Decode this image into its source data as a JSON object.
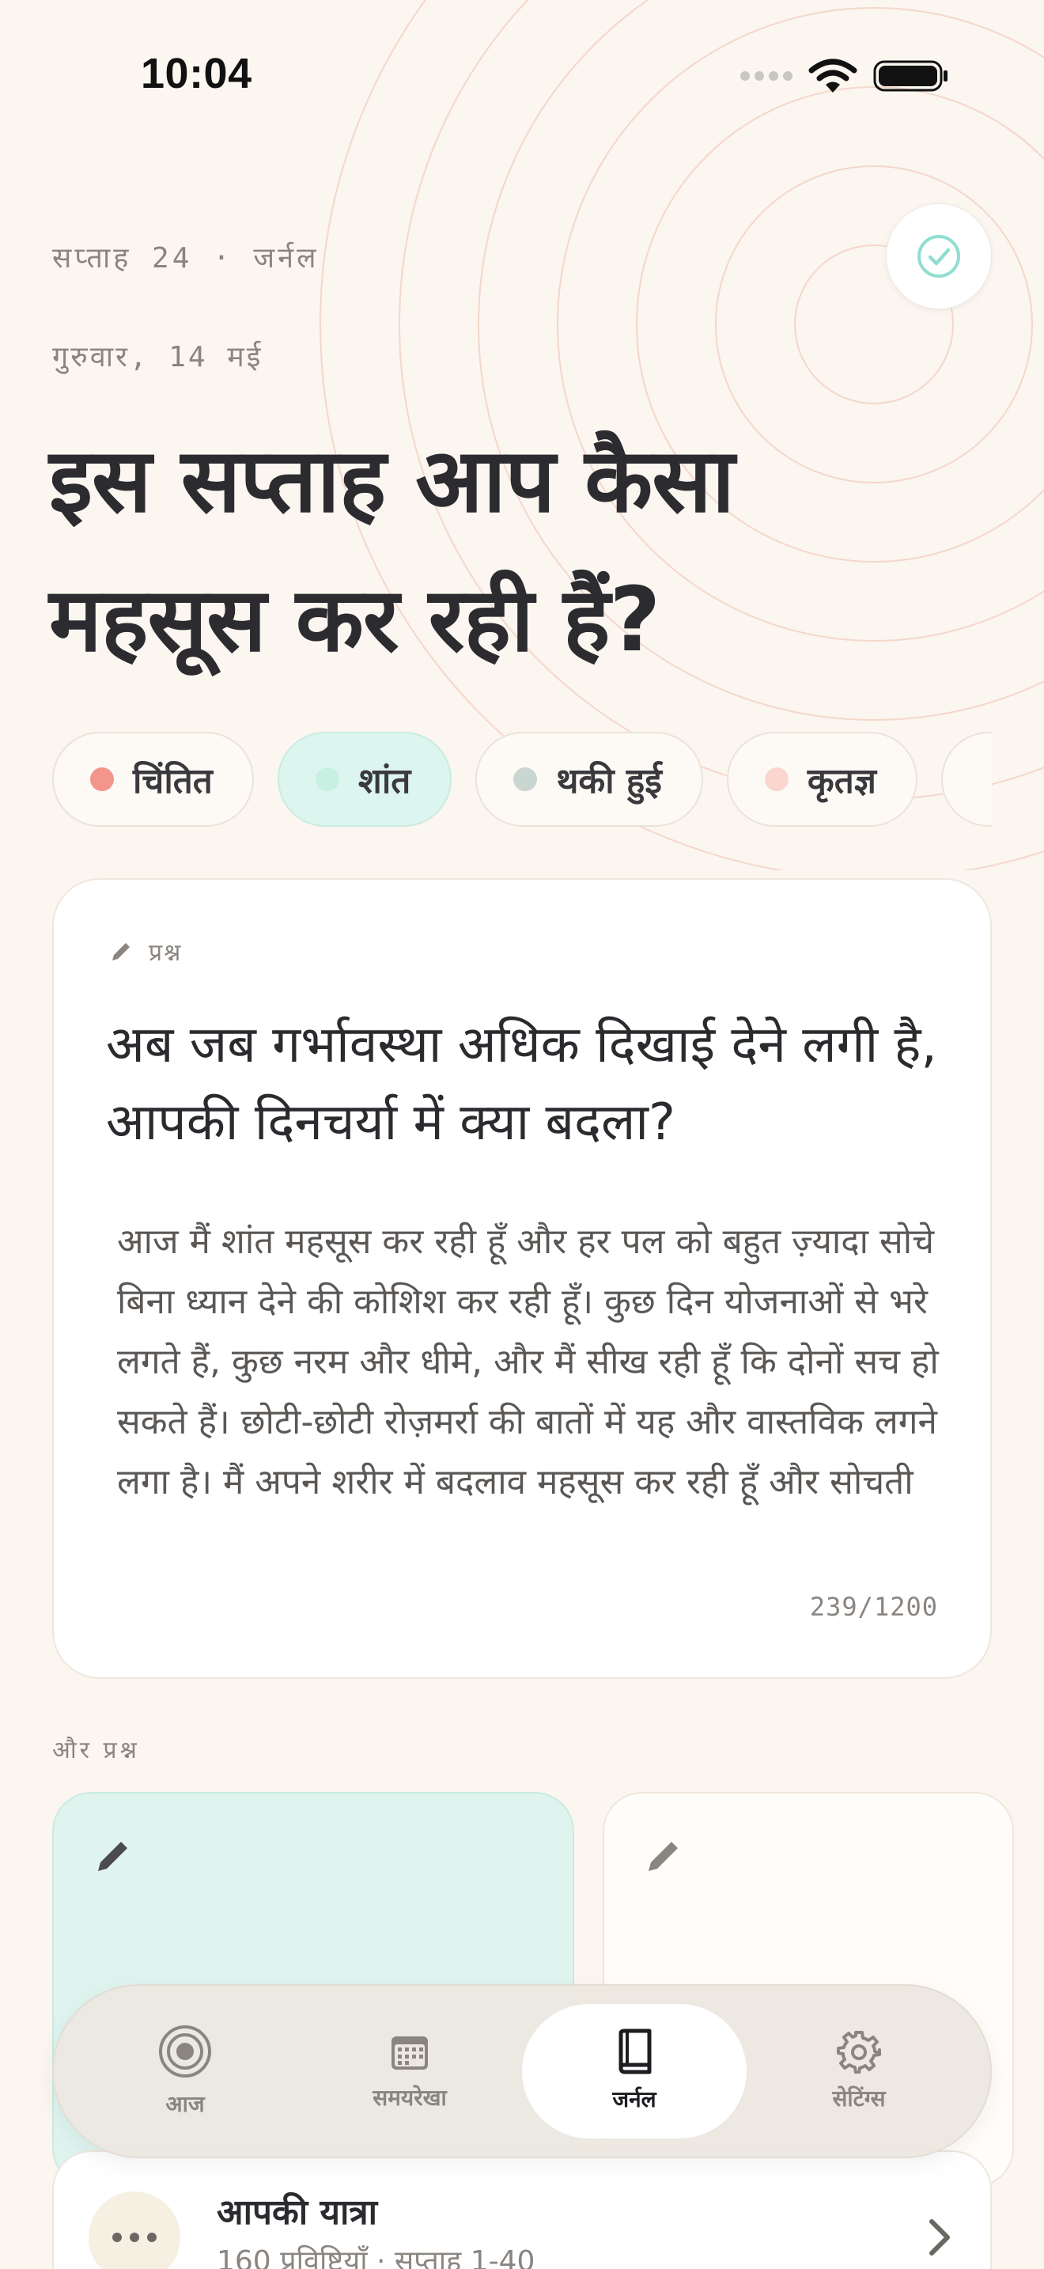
{
  "status_bar": {
    "time": "10:04"
  },
  "header": {
    "week_label": "सप्ताह 24 · जर्नल",
    "date_label": "गुरुवार, 14 मई",
    "title": "इस सप्ताह आप कैसा महसूस कर रही हैं?"
  },
  "moods": [
    {
      "label": "चिंतित",
      "color": "#f4958c"
    },
    {
      "label": "शांत",
      "color": "#c6f0e2"
    },
    {
      "label": "थकी हुई",
      "color": "#c9d6d2"
    },
    {
      "label": "कृतज्ञ",
      "color": "#fad6cf"
    }
  ],
  "question_card": {
    "tag_label": "प्रश्न",
    "question": "अब जब गर्भावस्था अधिक दिखाई देने लगी है, आपकी दिनचर्या में क्या बदला?",
    "answer": "आज मैं शांत महसूस कर रही हूँ और हर पल को बहुत ज़्यादा सोचे बिना ध्यान देने की कोशिश कर रही हूँ। कुछ दिन योजनाओं से भरे लगते हैं, कुछ नरम और धीमे, और मैं सीख रही हूँ कि दोनों सच हो सकते हैं। छोटी-छोटी रोज़मर्रा की बातों में यह और वास्तविक लगने लगा है। मैं अपने शरीर में बदलाव महसूस कर रही हूँ और सोचती",
    "counter": "239/1200"
  },
  "more_prompts": {
    "label": "और प्रश्न"
  },
  "tabs": [
    {
      "label": "आज",
      "icon": "target-icon"
    },
    {
      "label": "समयरेखा",
      "icon": "calendar-icon"
    },
    {
      "label": "जर्नल",
      "icon": "book-icon"
    },
    {
      "label": "सेटिंग्स",
      "icon": "gear-icon"
    }
  ],
  "journey": {
    "title": "आपकी यात्रा",
    "subtitle": "160 प्रविष्टियाँ · सप्ताह 1-40"
  },
  "colors": {
    "background": "#fbf6ef",
    "accent_mint": "#dcf5ee",
    "check_icon": "#8fded0",
    "rings": "#f2cdbf"
  }
}
